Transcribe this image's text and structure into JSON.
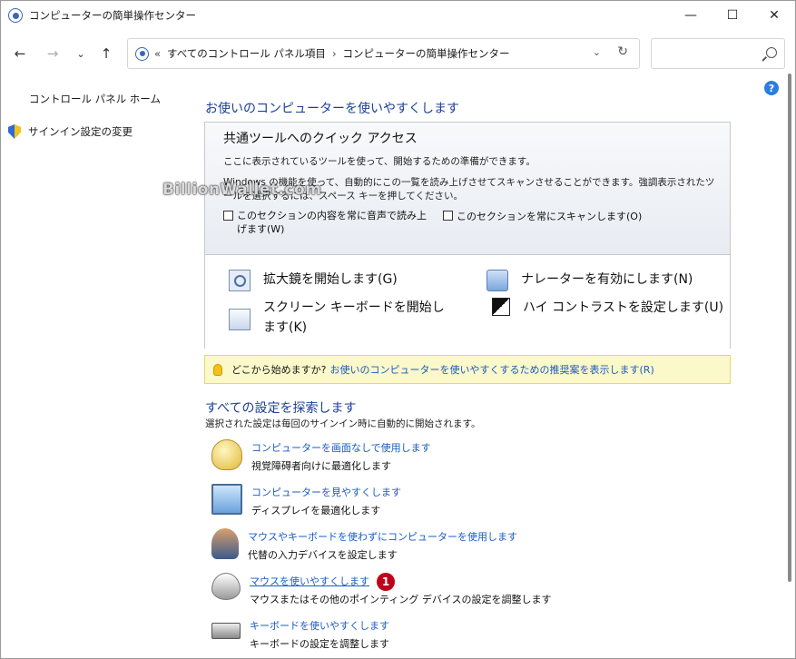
{
  "window": {
    "title": "コンピューターの簡単操作センター",
    "minimize": "—",
    "maximize": "☐",
    "close": "✕"
  },
  "nav": {
    "back": "←",
    "forward": "→",
    "recent": "⌄",
    "up": "↑",
    "breadcrumb_prefix": "«",
    "breadcrumb": [
      "すべてのコントロール パネル項目",
      "コンピューターの簡単操作センター"
    ],
    "breadcrumb_sep": "›",
    "dropdown": "⌄",
    "refresh": "↻",
    "search_placeholder": ""
  },
  "sidebar": {
    "home": "コントロール パネル ホーム",
    "signin": "サインイン設定の変更"
  },
  "main": {
    "heading": "お使いのコンピューターを使いやすくします",
    "quick_access": {
      "title": "共通ツールへのクイック アクセス",
      "desc1": "ここに表示されているツールを使って、開始するための準備ができます。",
      "desc2": "Windows の機能を使って、自動的にこの一覧を読み上げさせてスキャンさせることができます。強調表示されたツールを選択するには、スペース キーを押してください。",
      "cb_read": "このセクションの内容を常に音声で読み上げます(W)",
      "cb_scan": "このセクションを常にスキャンします(O)",
      "tools": {
        "magnifier": "拡大鏡を開始します(G)",
        "narrator": "ナレーターを有効にします(N)",
        "keyboard": "スクリーン キーボードを開始します(K)",
        "contrast": "ハイ コントラストを設定します(U)"
      }
    },
    "tip": {
      "prefix": "どこから始めますか?",
      "link": "お使いのコンピューターを使いやすくするための推奨案を表示します(R)"
    },
    "explore": {
      "heading": "すべての設定を探索します",
      "sub": "選択された設定は毎回のサインイン時に自動的に開始されます。",
      "items": [
        {
          "link": "コンピューターを画面なしで使用します",
          "desc": "視覚障碍者向けに最適化します"
        },
        {
          "link": "コンピューターを見やすくします",
          "desc": "ディスプレイを最適化します"
        },
        {
          "link": "マウスやキーボードを使わずにコンピューターを使用します",
          "desc": "代替の入力デバイスを設定します"
        },
        {
          "link": "マウスを使いやすくします",
          "desc": "マウスまたはその他のポインティング デバイスの設定を調整します"
        },
        {
          "link": "キーボードを使いやすくします",
          "desc": "キーボードの設定を調整します"
        }
      ],
      "badge": "1"
    },
    "help": "?",
    "watermark": "BillionWallet.com"
  }
}
